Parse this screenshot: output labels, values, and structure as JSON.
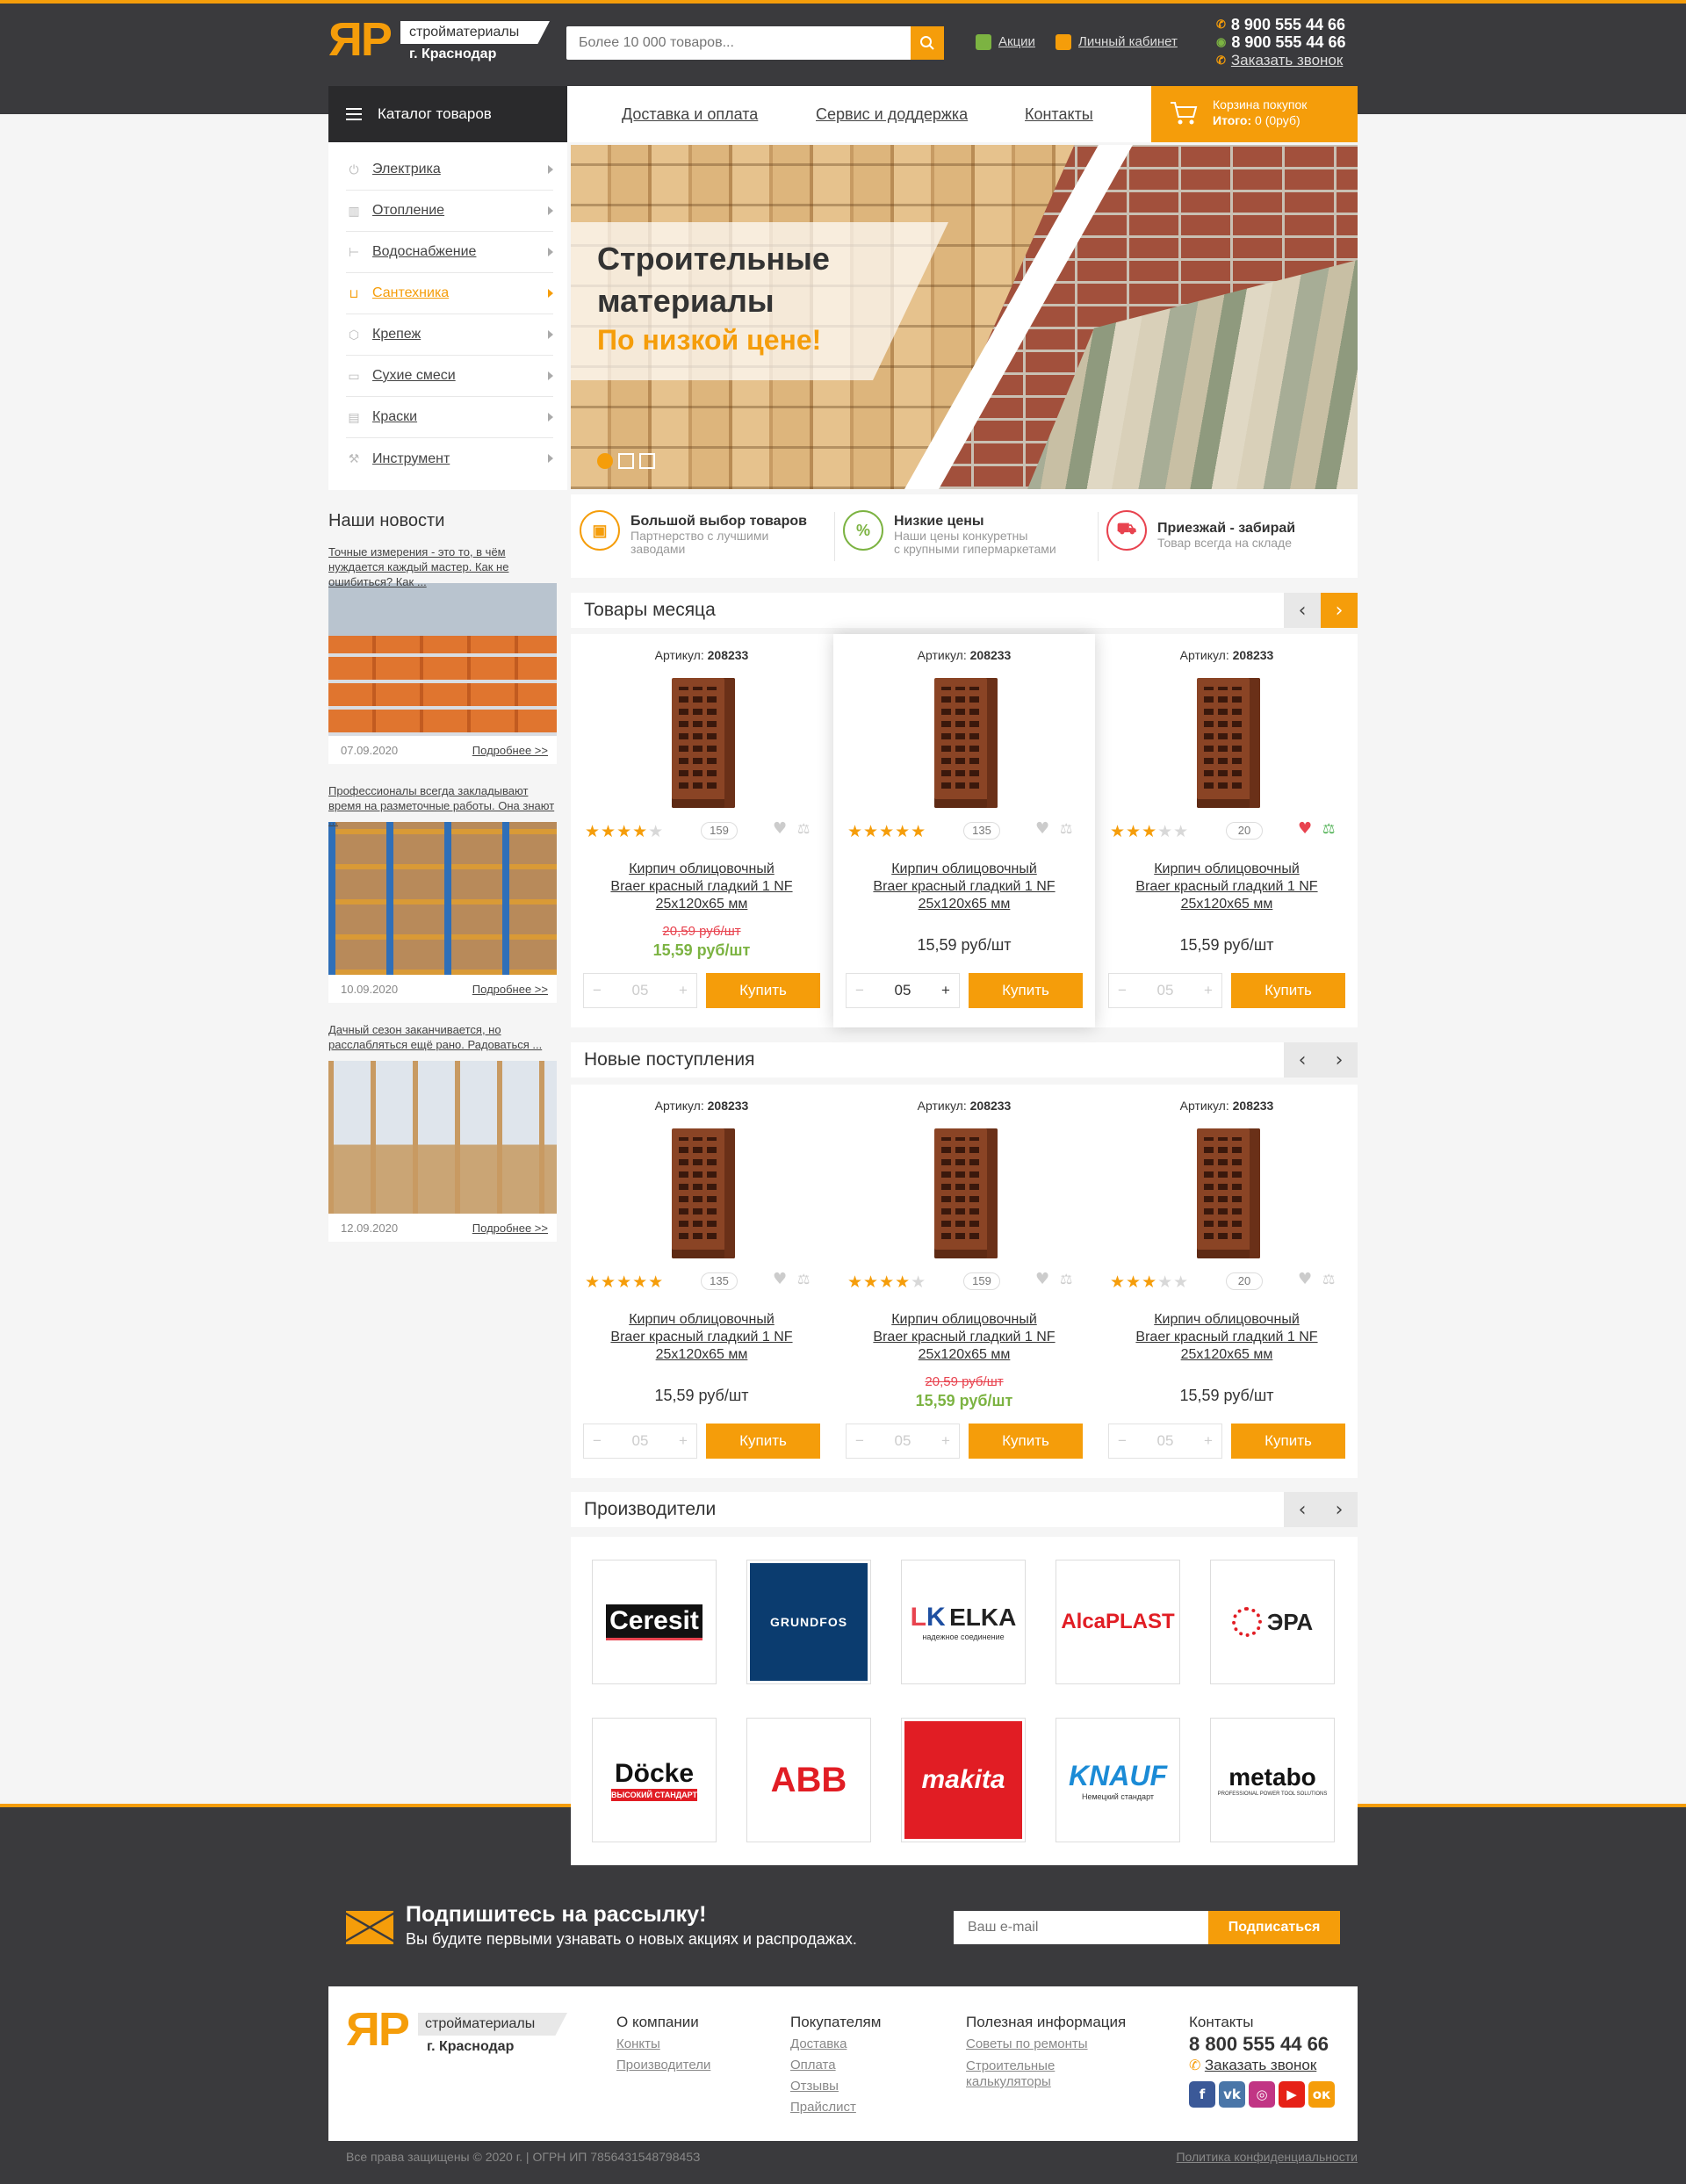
{
  "header": {
    "logo_mark": "ЯР",
    "logo_name": "стройматериалы",
    "logo_city": "г. Краснодар",
    "search_placeholder": "Более 10 000 товаров...",
    "promo_link": "Акции",
    "account_link": "Личный кабинет",
    "phone1": "8 900 555 44 66",
    "phone2": "8 900 555 44 66",
    "callback": "Заказать звонок"
  },
  "nav": {
    "catalog": "Каталог товаров",
    "links": [
      "Доставка и оплата",
      "Сервис и доддержка",
      "Контакты"
    ],
    "cart_title": "Корзина покупок",
    "cart_total_label": "Итого:",
    "cart_total_value": "0 (0руб)"
  },
  "sidebar": {
    "items": [
      {
        "label": "Электрика",
        "icon": "plug-icon"
      },
      {
        "label": "Отопление",
        "icon": "radiator-icon"
      },
      {
        "label": "Водоснабжение",
        "icon": "faucet-icon"
      },
      {
        "label": "Сантехника",
        "icon": "bathtub-icon",
        "active": true
      },
      {
        "label": "Крепеж",
        "icon": "bolt-icon"
      },
      {
        "label": "Сухие смеси",
        "icon": "bag-icon"
      },
      {
        "label": "Краски",
        "icon": "paint-icon"
      },
      {
        "label": "Инструмент",
        "icon": "tools-icon"
      }
    ]
  },
  "hero": {
    "line1": "Строительные",
    "line2": "материалы",
    "line3": "По низкой цене!",
    "slides": 3,
    "active_slide": 1
  },
  "features": [
    {
      "title": "Большой выбор товаров",
      "desc1": "Партнерство с лучшими",
      "desc2": "заводами",
      "icon": "cube-icon"
    },
    {
      "title": "Низкие цены",
      "desc1": "Наши цены конкуретны",
      "desc2": "с крупными гипермаркетами",
      "icon": "percent-icon"
    },
    {
      "title": "Приезжай - забирай",
      "desc1": "Товар всегда на складе",
      "desc2": "",
      "icon": "truck-icon"
    }
  ],
  "news": {
    "title": "Наши новости",
    "more_label": "Подробнее >>",
    "items": [
      {
        "text": "Точные измерения - это то, в чём нуждается каждый мастер. Как не ошибиться? Как ...",
        "date": "07.09.2020"
      },
      {
        "text": "Профессионалы всегда закладывают время на разметочные работы. Она знают ...",
        "date": "10.09.2020"
      },
      {
        "text": "Дачный сезон заканчивается, но расслабляться ещё рано. Радоваться ...",
        "date": "12.09.2020"
      }
    ]
  },
  "sections": {
    "month": "Товары месяца",
    "new": "Новые поступления",
    "makers": "Производители"
  },
  "product": {
    "art_label": "Артикул:",
    "art_value": "208233",
    "name1": "Кирпич облицовочный",
    "name2": "Braer красный гладкий 1 NF",
    "name3": "25x120x65 мм",
    "old_price": "20,59 руб/шт",
    "price": "15,59 руб/шт",
    "qty": "05",
    "buy": "Купить"
  },
  "month_products": [
    {
      "rating": 4,
      "reviews": "159",
      "sale": true
    },
    {
      "rating": 5,
      "reviews": "135",
      "sale": false
    },
    {
      "rating": 3,
      "reviews": "20",
      "sale": false
    }
  ],
  "new_products": [
    {
      "rating": 5,
      "reviews": "135",
      "sale": false
    },
    {
      "rating": 4,
      "reviews": "159",
      "sale": true
    },
    {
      "rating": 3,
      "reviews": "20",
      "sale": false
    }
  ],
  "makers": [
    "Ceresit",
    "GRUNDFOS",
    "ELKA",
    "AlcaPLAST",
    "ЭРА",
    "Döcke",
    "ABB",
    "makita",
    "KNAUF",
    "metabo"
  ],
  "maker_sub": {
    "elka": "надежное соединение",
    "docke": "ВЫСОКИЙ СТАНДАРТ",
    "knauf": "Немецкий стандарт",
    "metabo": "PROFESSIONAL POWER TOOL SOLUTIONS"
  },
  "subscribe": {
    "title": "Подпишитесь на рассылку!",
    "text": "Вы будите первыми узнавать о новых акциях и распродажах.",
    "placeholder": "Ваш e-mail",
    "button": "Подписаться"
  },
  "footer": {
    "col1_title": "О компании",
    "col1": [
      "Конкты",
      "Производители"
    ],
    "col2_title": "Покупателям",
    "col2": [
      "Доставка",
      "Оплата",
      "Отзывы",
      "Прайслист"
    ],
    "col3_title": "Полезная информация",
    "col3": [
      "Советы по ремонты",
      "Строительные",
      "калькуляторы"
    ],
    "contacts_title": "Контакты",
    "phone": "8 800 555 44 66",
    "callback": "Заказать звонок",
    "copyright": "Все права защищены © 2020 г. | ОГРН ИП 785643154879845З",
    "privacy": "Политика конфиденциальности"
  },
  "colors": {
    "accent": "#f59d0a",
    "dark": "#3a3a3d",
    "sale": "#e8434f",
    "green": "#7cb342"
  }
}
